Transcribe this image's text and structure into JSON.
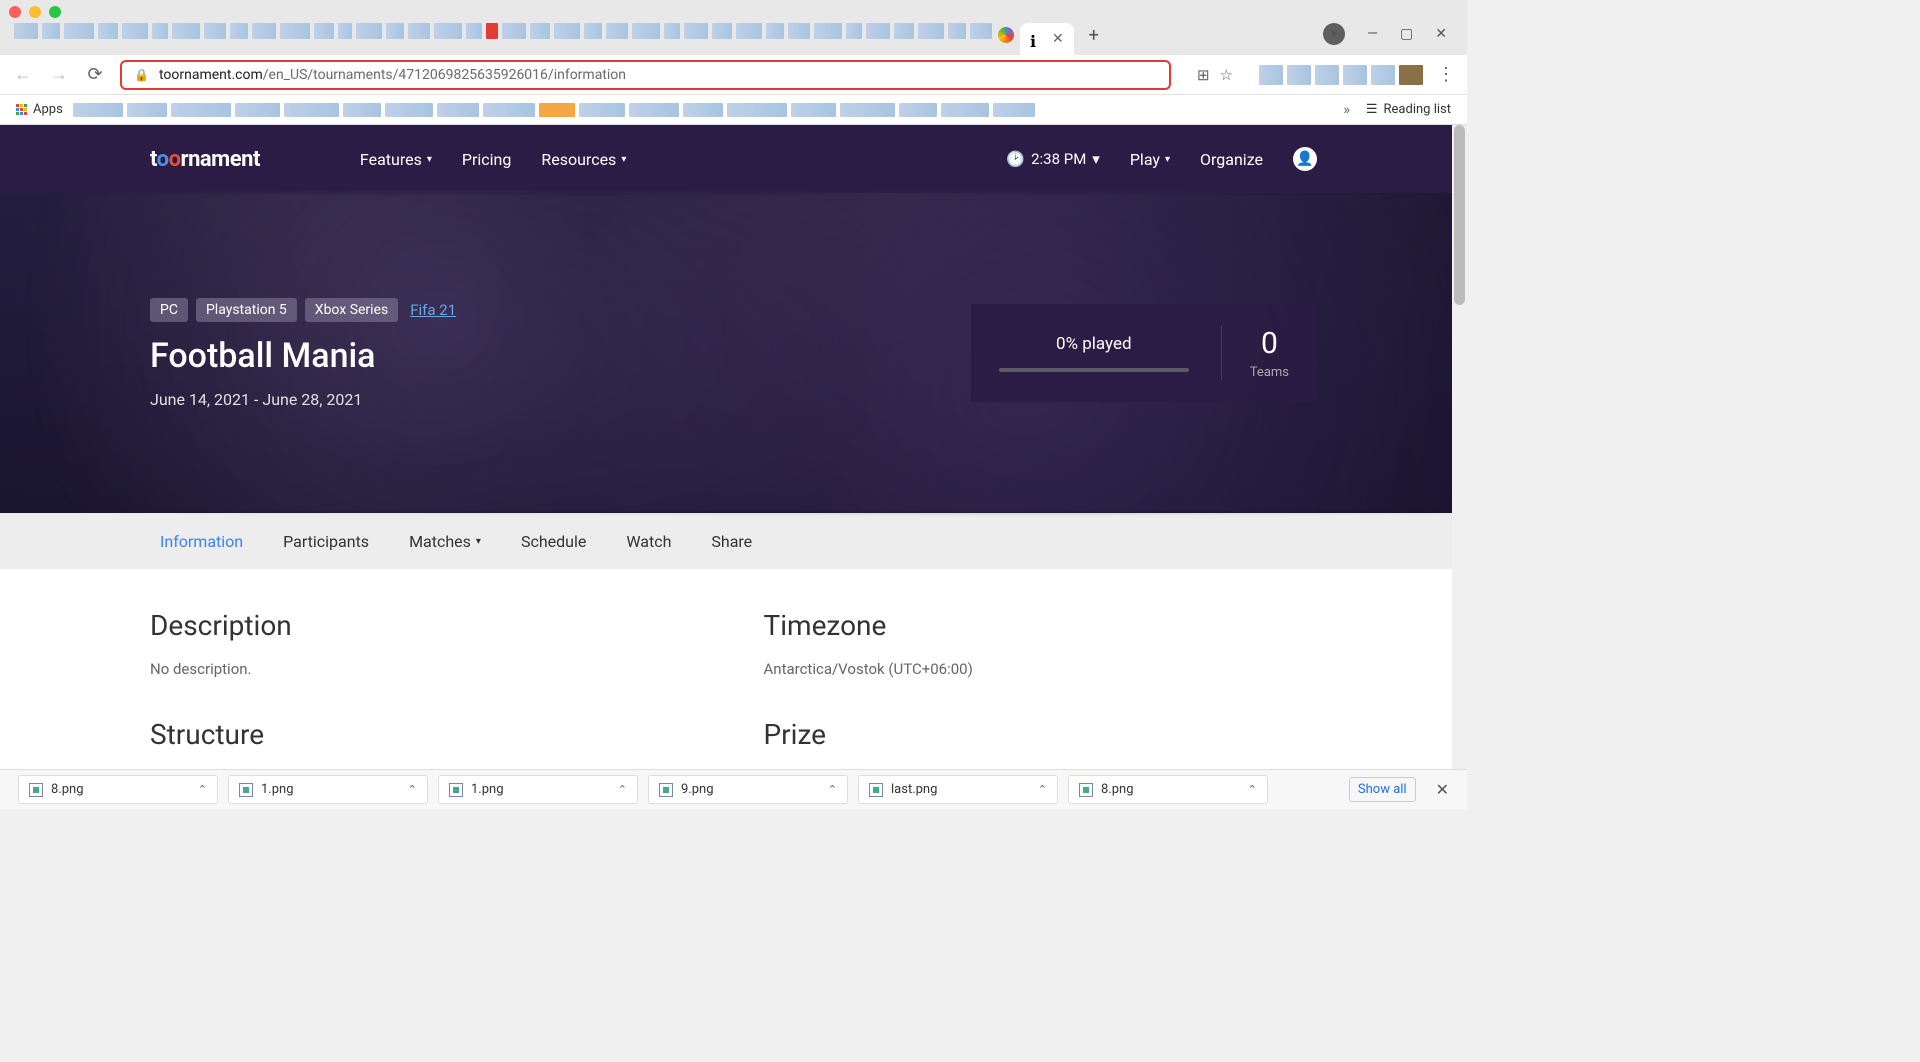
{
  "browser": {
    "url_domain": "toornament.com",
    "url_path": "/en_US/tournaments/4712069825635926016/information",
    "apps": "Apps",
    "reading_list": "Reading list"
  },
  "topnav": {
    "logo": "t  rnament",
    "features": "Features",
    "pricing": "Pricing",
    "resources": "Resources",
    "time": "2:38 PM",
    "play": "Play",
    "organize": "Organize"
  },
  "hero": {
    "badges": [
      "PC",
      "Playstation 5",
      "Xbox Series"
    ],
    "game_link": "Fifa 21",
    "title": "Football Mania",
    "dates": "June 14, 2021 - June 28, 2021"
  },
  "stats": {
    "played": "0% played",
    "teams_num": "0",
    "teams_lbl": "Teams"
  },
  "subnav": {
    "information": "Information",
    "participants": "Participants",
    "matches": "Matches",
    "schedule": "Schedule",
    "watch": "Watch",
    "share": "Share"
  },
  "content": {
    "description_h": "Description",
    "description_v": "No description.",
    "timezone_h": "Timezone",
    "timezone_v": "Antarctica/Vostok (UTC+06:00)",
    "structure_h": "Structure",
    "prize_h": "Prize"
  },
  "downloads": {
    "items": [
      "8.png",
      "1.png",
      "1.png",
      "9.png",
      "last.png",
      "8.png"
    ],
    "show_all": "Show all"
  }
}
